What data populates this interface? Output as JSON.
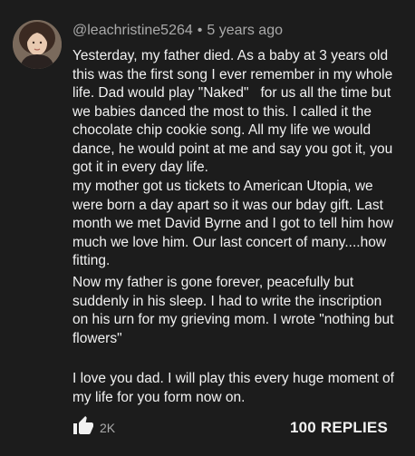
{
  "comment": {
    "author": "@leachristine5264",
    "separator": "•",
    "timestamp": "5 years ago",
    "paragraphs": [
      "Yesterday, my father died. As a baby at 3 years old this was the first song I ever remember in my whole life. Dad would play \"Naked\"   for us all the time but we babies danced the most to this. I called it the chocolate chip cookie song. All my life we would dance, he would point at me and say you got it, you got it in every day life.",
      "my mother got us tickets to American Utopia, we were born a day apart so it was our bday gift. Last month we met David Byrne and I got to tell him how much we love him. Our last concert of many....how fitting.",
      "Now my father is gone forever, peacefully but suddenly in his sleep. I had to write the inscription on his urn for my grieving mom. I wrote \"nothing but flowers\"",
      "I love you dad. I will play this every huge moment of my life for you form now on."
    ],
    "like_count": "2K",
    "replies_label": "100 REPLIES",
    "like_icon": "thumbs-up-icon",
    "avatar_icon": "user-avatar"
  },
  "colors": {
    "background": "#1c1c1c",
    "text_primary": "#f1f1f1",
    "text_secondary": "#aaaaaa"
  }
}
